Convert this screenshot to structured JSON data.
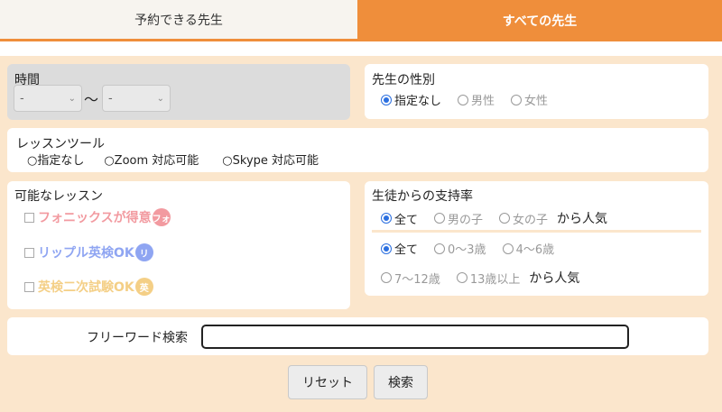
{
  "tabs": {
    "available": "予約できる先生",
    "all": "すべての先生"
  },
  "time": {
    "title": "時間",
    "from": "-",
    "to": "-",
    "separator": "〜"
  },
  "gender": {
    "title": "先生の性別",
    "options": [
      "指定なし",
      "男性",
      "女性"
    ],
    "selected": "指定なし"
  },
  "tool": {
    "title": "レッスンツール",
    "options": [
      "○指定なし",
      "○Zoom 対応可能",
      "○Skype 対応可能"
    ]
  },
  "lessons": {
    "title": "可能なレッスン",
    "items": [
      {
        "label": "フォニックスが得意",
        "badge": "フォ",
        "color": "#f29aa0"
      },
      {
        "label": "リップル英検OK",
        "badge": "リ",
        "color": "#8fa5f2"
      },
      {
        "label": "英検二次試験OK",
        "badge": "英",
        "color": "#f4cf86"
      }
    ]
  },
  "support": {
    "title": "生徒からの支持率",
    "gender_options": [
      "全て",
      "男の子",
      "女の子"
    ],
    "age_row1": [
      "全て",
      "0〜3歳",
      "4〜6歳"
    ],
    "age_row2": [
      "7〜12歳",
      "13歳以上"
    ],
    "suffix": "から人気"
  },
  "freeword": {
    "label": "フリーワード検索",
    "value": ""
  },
  "buttons": {
    "reset": "リセット",
    "search": "検索"
  }
}
